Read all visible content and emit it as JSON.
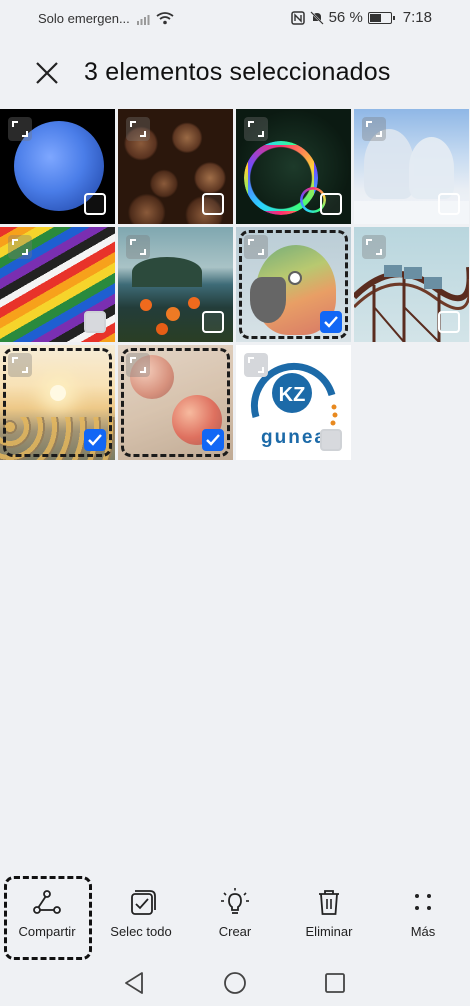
{
  "status_bar": {
    "carrier": "Solo emergen...",
    "battery_percent": "56 %",
    "time": "7:18"
  },
  "header": {
    "title": "3 elementos seleccionados"
  },
  "grid": {
    "items": [
      {
        "name": "moon-photo",
        "selected": false
      },
      {
        "name": "coffee-beans-photo",
        "selected": false
      },
      {
        "name": "soap-bubble-photo",
        "selected": false
      },
      {
        "name": "snowy-trees-photo",
        "selected": false
      },
      {
        "name": "colored-pencils-photo",
        "selected": false
      },
      {
        "name": "island-flowers-photo",
        "selected": false
      },
      {
        "name": "parrot-photo",
        "selected": true
      },
      {
        "name": "roller-coaster-photo",
        "selected": false
      },
      {
        "name": "sunflowers-photo",
        "selected": true
      },
      {
        "name": "apples-photo",
        "selected": true
      },
      {
        "name": "kz-gunea-logo",
        "selected": false
      }
    ],
    "logo_text": "gunea",
    "logo_mark": "KZ"
  },
  "toolbar": {
    "share_label": "Compartir",
    "select_all_label": "Selec todo",
    "create_label": "Crear",
    "delete_label": "Eliminar",
    "more_label": "Más"
  },
  "colors": {
    "accent": "#1267f5",
    "background": "#eff1f4"
  }
}
